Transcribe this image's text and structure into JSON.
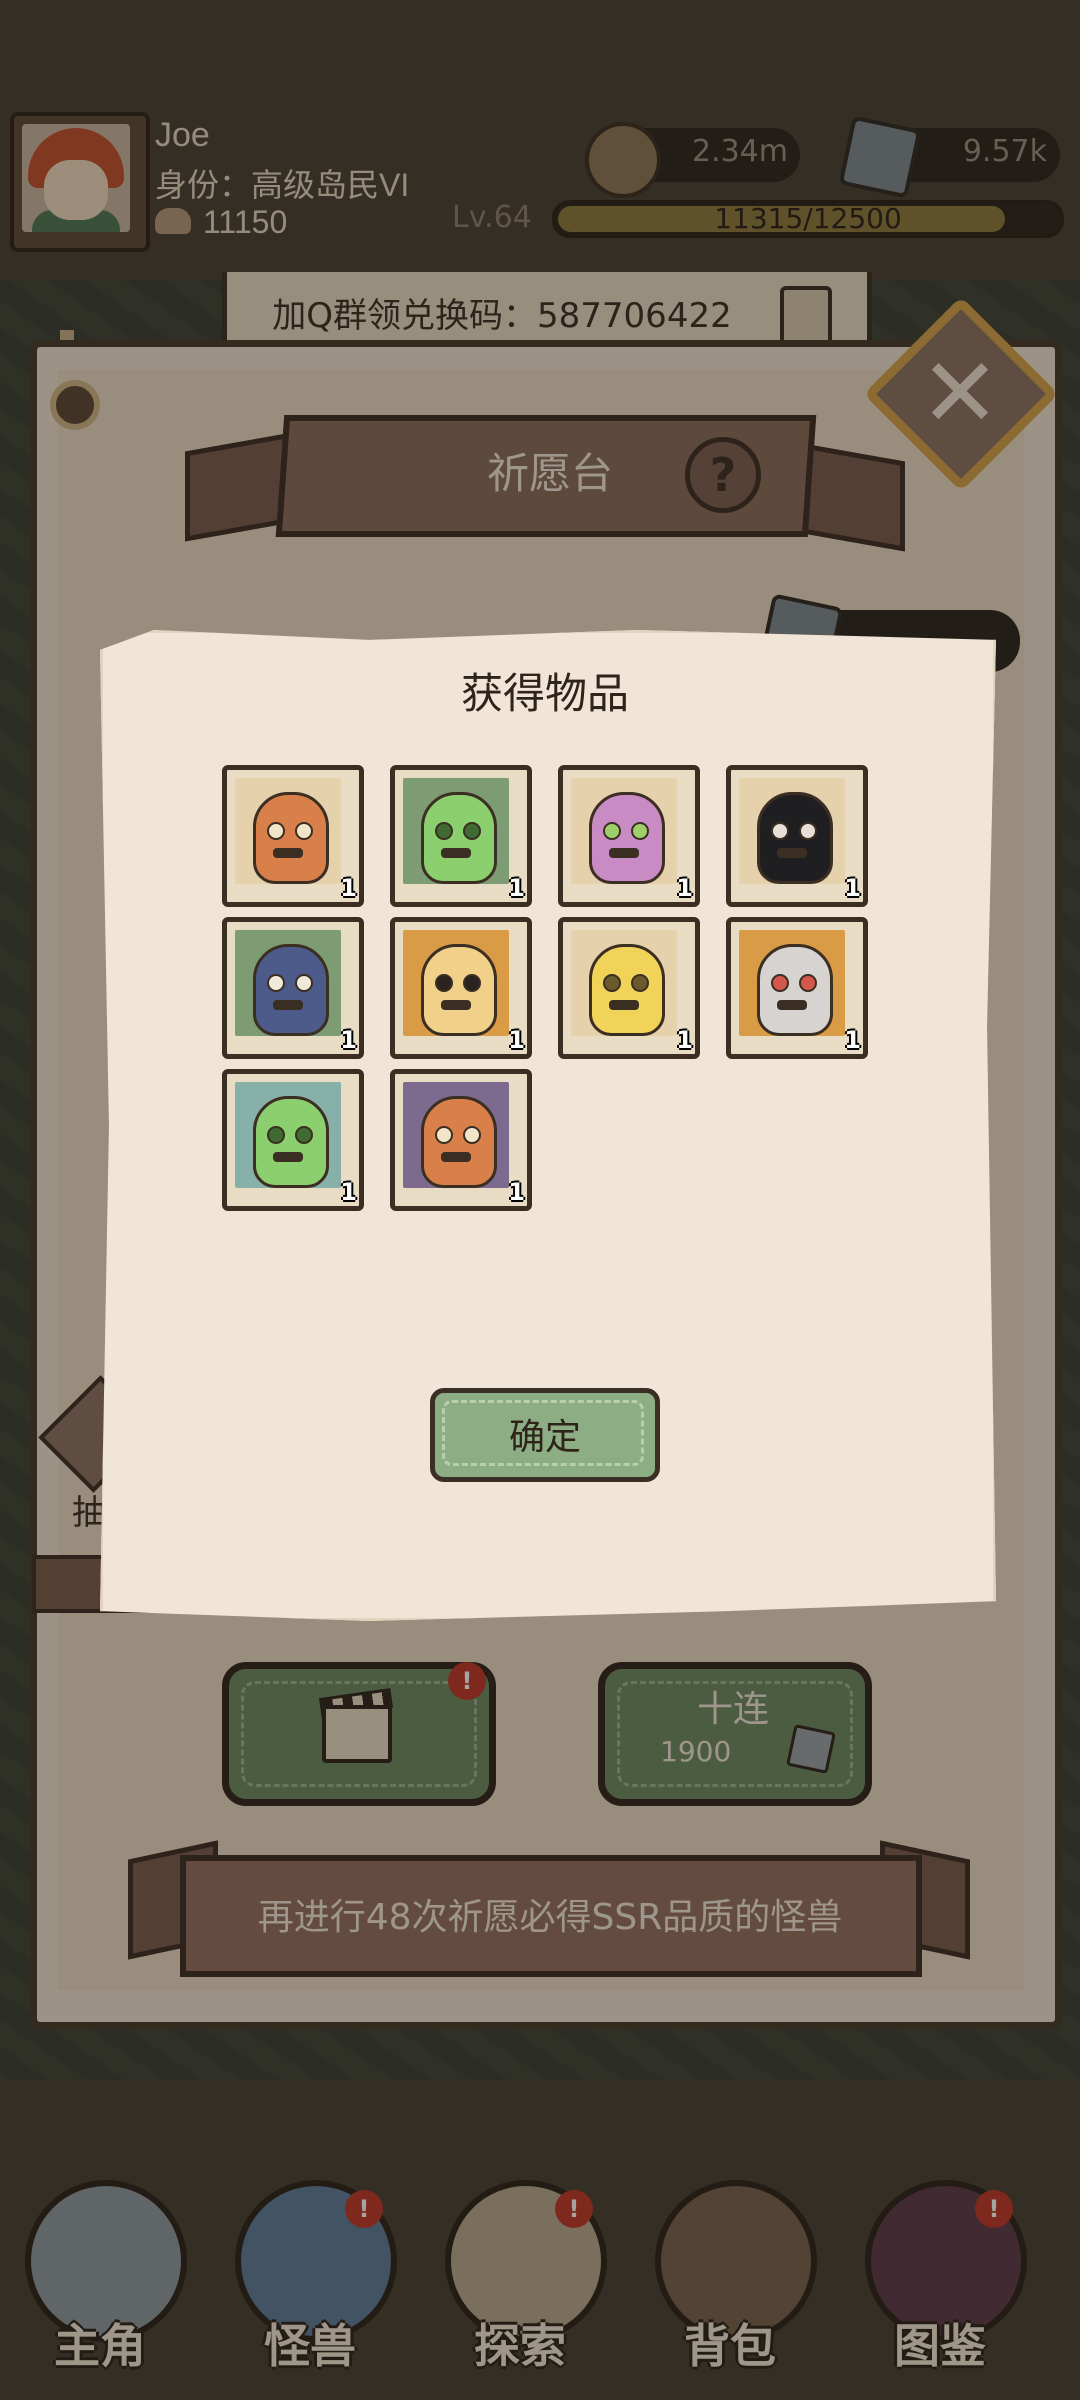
{
  "header": {
    "player_name": "Joe",
    "player_title": "身份：高级岛民VI",
    "stamina": "11150",
    "coins": "2.34m",
    "gems": "9.57k",
    "level": "Lv.64",
    "xp_text": "11315/12500",
    "xp_progress": 0.905
  },
  "code_banner": {
    "text": "加Q群领兑换码：587706422",
    "copy_icon": "copy-icon"
  },
  "panel": {
    "title": "祈愿台",
    "help_label": "?",
    "close_icon": "close-icon",
    "side_label": "抽",
    "ten_pull": {
      "label": "十连",
      "cost": "1900"
    },
    "ad_icon": "clapperboard-icon",
    "ad_badge": "!",
    "guarantee_text": "再进行48次祈愿必得SSR品质的怪兽"
  },
  "result_popup": {
    "title": "获得物品",
    "confirm_label": "确定",
    "items": [
      {
        "icon": "potato-monster-icon",
        "count": "1",
        "frame": "tan"
      },
      {
        "icon": "green-slime-icon",
        "count": "1",
        "frame": "green"
      },
      {
        "icon": "purple-blob-monster-icon",
        "count": "1",
        "frame": "tan"
      },
      {
        "icon": "ghost-girl-icon",
        "count": "1",
        "frame": "tan"
      },
      {
        "icon": "mimic-mouth-icon",
        "count": "1",
        "frame": "green"
      },
      {
        "icon": "flame-spirit-icon",
        "count": "1",
        "frame": "gold"
      },
      {
        "icon": "yellow-chick-icon",
        "count": "1",
        "frame": "tan"
      },
      {
        "icon": "red-demon-girl-icon",
        "count": "1",
        "frame": "gold"
      },
      {
        "icon": "green-slime-icon",
        "count": "1",
        "frame": "teal"
      },
      {
        "icon": "potato-monster-icon",
        "count": "1",
        "frame": "purple"
      }
    ]
  },
  "nav": {
    "items": [
      {
        "label": "主角",
        "icon": "knight-helmet-icon",
        "badge": ""
      },
      {
        "label": "怪兽",
        "icon": "eyeball-monster-icon",
        "badge": "!"
      },
      {
        "label": "探索",
        "icon": "map-scroll-icon",
        "badge": "!"
      },
      {
        "label": "背包",
        "icon": "backpack-icon",
        "badge": ""
      },
      {
        "label": "图鉴",
        "icon": "monster-book-icon",
        "badge": "!"
      }
    ]
  }
}
